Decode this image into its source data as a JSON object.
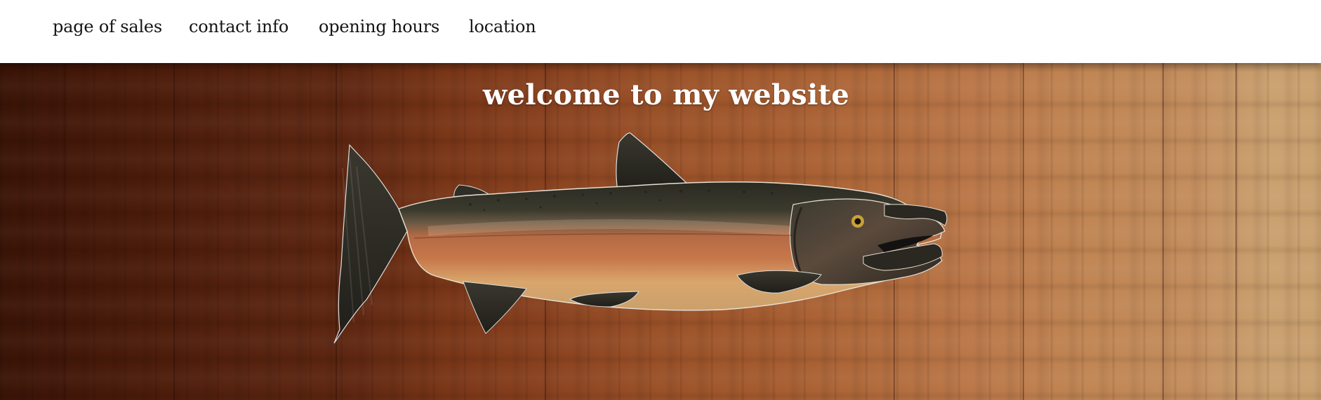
{
  "nav": {
    "items": [
      {
        "label": "page of sales"
      },
      {
        "label": "contact info"
      },
      {
        "label": "opening hours"
      },
      {
        "label": "location"
      }
    ]
  },
  "hero": {
    "title": "welcome to my website",
    "image_subject": "salmon-illustration"
  },
  "colors": {
    "nav_background": "#ffffff",
    "nav_text": "#141414",
    "title_text": "#ffffff",
    "wood_dark": "#3a1407",
    "wood_light": "#caa06f"
  }
}
